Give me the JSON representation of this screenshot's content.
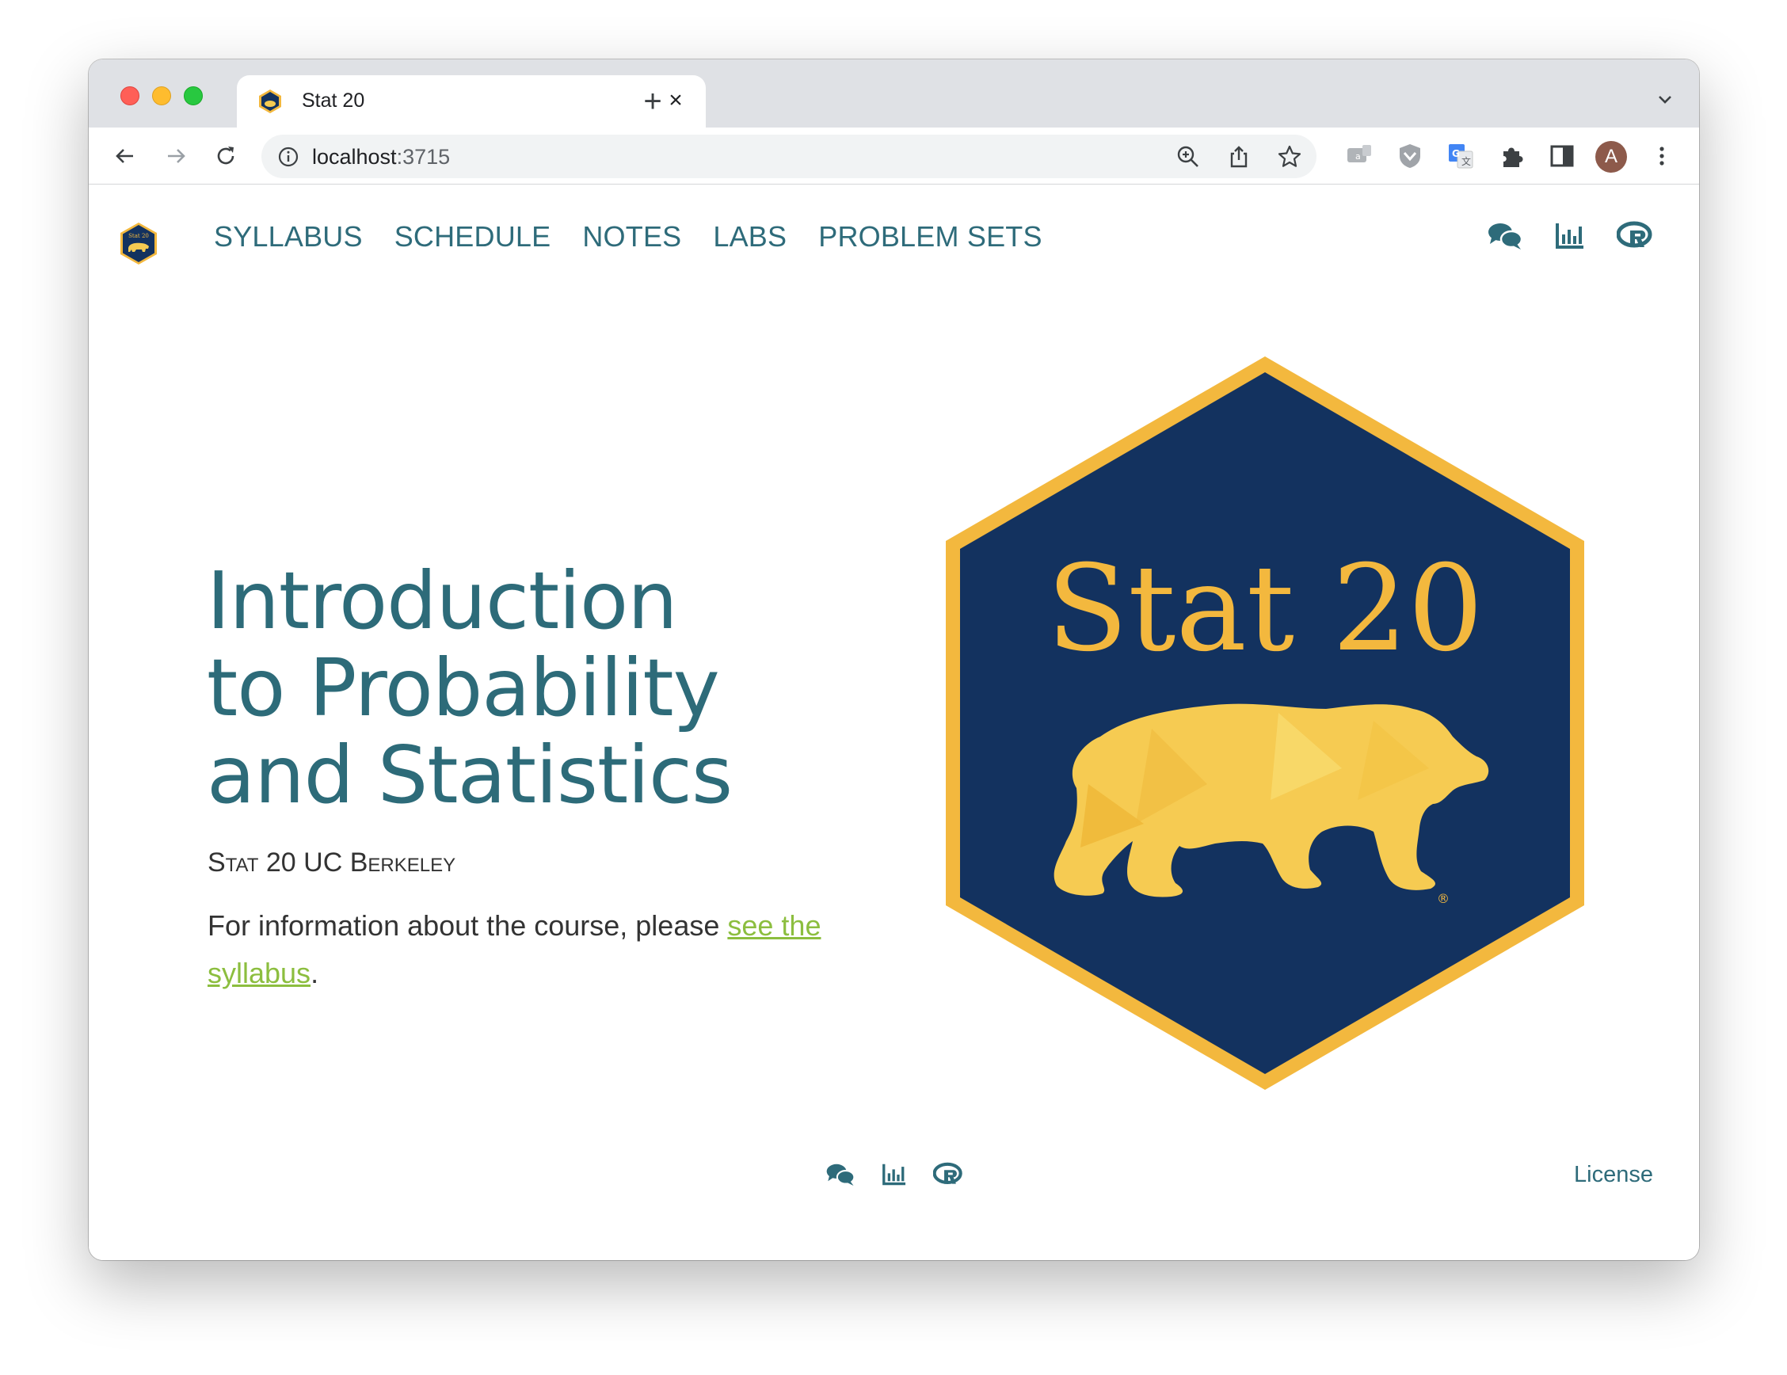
{
  "browser": {
    "tab_title": "Stat 20",
    "tab_close": "×",
    "new_tab": "+",
    "url_host": "localhost",
    "url_port": ":3715",
    "avatar_initial": "A"
  },
  "nav": {
    "links": [
      "SYLLABUS",
      "SCHEDULE",
      "NOTES",
      "LABS",
      "PROBLEM SETS"
    ]
  },
  "hero": {
    "title_lines": [
      "Introduction",
      "to Probability",
      "and Statistics"
    ],
    "subtitle": "Stat 20 UC Berkeley",
    "info_prefix": "For information about the course, please ",
    "info_link": "see the syllabus",
    "info_suffix": "."
  },
  "logo": {
    "text": "Stat 20",
    "registered_mark": "®",
    "colors": {
      "navy": "#13325f",
      "gold": "#f3b83e",
      "bear": "#f6cb52"
    }
  },
  "footer": {
    "license": "License"
  },
  "colors": {
    "nav_link": "#2e6b7a",
    "title": "#2d6b79",
    "link_green": "#8cbe3f"
  }
}
